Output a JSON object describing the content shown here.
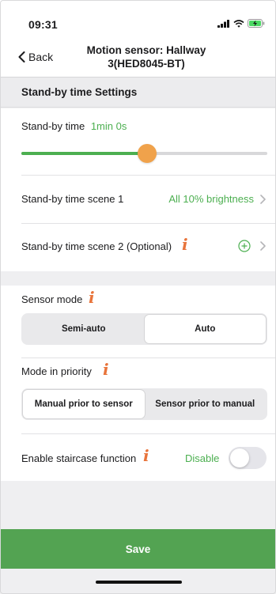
{
  "status_bar": {
    "time": "09:31"
  },
  "nav": {
    "back_label": "Back",
    "title_line1": "Motion sensor: Hallway",
    "title_line2": "3(HED8045-BT)"
  },
  "section": {
    "header": "Stand-by time Settings"
  },
  "standby": {
    "label": "Stand-by time",
    "value": "1min 0s",
    "slider_fraction": 0.5
  },
  "scene1": {
    "label": "Stand-by time scene 1",
    "value": "All 10% brightness"
  },
  "scene2": {
    "label": "Stand-by time scene 2 (Optional)"
  },
  "sensor_mode": {
    "label": "Sensor mode",
    "options": [
      "Semi-auto",
      "Auto"
    ],
    "selected": "Auto"
  },
  "priority": {
    "label": "Mode in priority",
    "options": [
      "Manual prior to sensor",
      "Sensor prior to manual"
    ],
    "selected": "Manual prior to sensor"
  },
  "staircase": {
    "label": "Enable staircase function",
    "status": "Disable",
    "enabled": false
  },
  "save_label": "Save",
  "colors": {
    "accent_green": "#4caf50",
    "save_green": "#53a352",
    "slider_thumb": "#f0a24b",
    "info_orange": "#e8743b"
  },
  "icons": [
    "back-chevron-icon",
    "info-icon",
    "add-circle-icon",
    "chevron-right-icon",
    "signal-icon",
    "wifi-icon",
    "battery-charging-icon"
  ]
}
